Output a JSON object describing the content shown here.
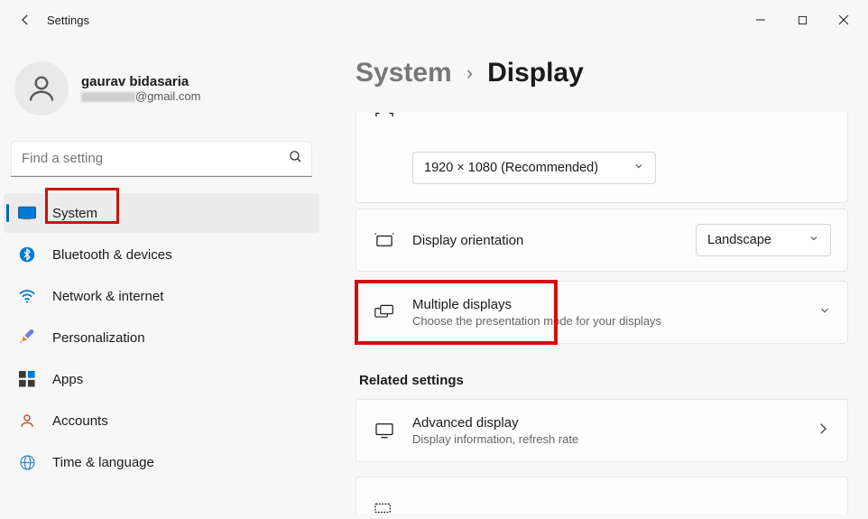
{
  "window": {
    "title": "Settings"
  },
  "profile": {
    "name": "gaurav bidasaria",
    "email_domain": "@gmail.com"
  },
  "search": {
    "placeholder": "Find a setting"
  },
  "sidebar": {
    "items": [
      {
        "label": "System",
        "icon": "system",
        "active": true
      },
      {
        "label": "Bluetooth & devices",
        "icon": "bluetooth"
      },
      {
        "label": "Network & internet",
        "icon": "wifi"
      },
      {
        "label": "Personalization",
        "icon": "personalization"
      },
      {
        "label": "Apps",
        "icon": "apps"
      },
      {
        "label": "Accounts",
        "icon": "accounts"
      },
      {
        "label": "Time & language",
        "icon": "globe"
      }
    ]
  },
  "breadcrumb": {
    "parent": "System",
    "current": "Display"
  },
  "resolution": {
    "value": "1920 × 1080 (Recommended)"
  },
  "orientation": {
    "label": "Display orientation",
    "value": "Landscape"
  },
  "multiple": {
    "title": "Multiple displays",
    "sub": "Choose the presentation mode for your displays"
  },
  "related": {
    "heading": "Related settings"
  },
  "advanced": {
    "title": "Advanced display",
    "sub": "Display information, refresh rate"
  }
}
